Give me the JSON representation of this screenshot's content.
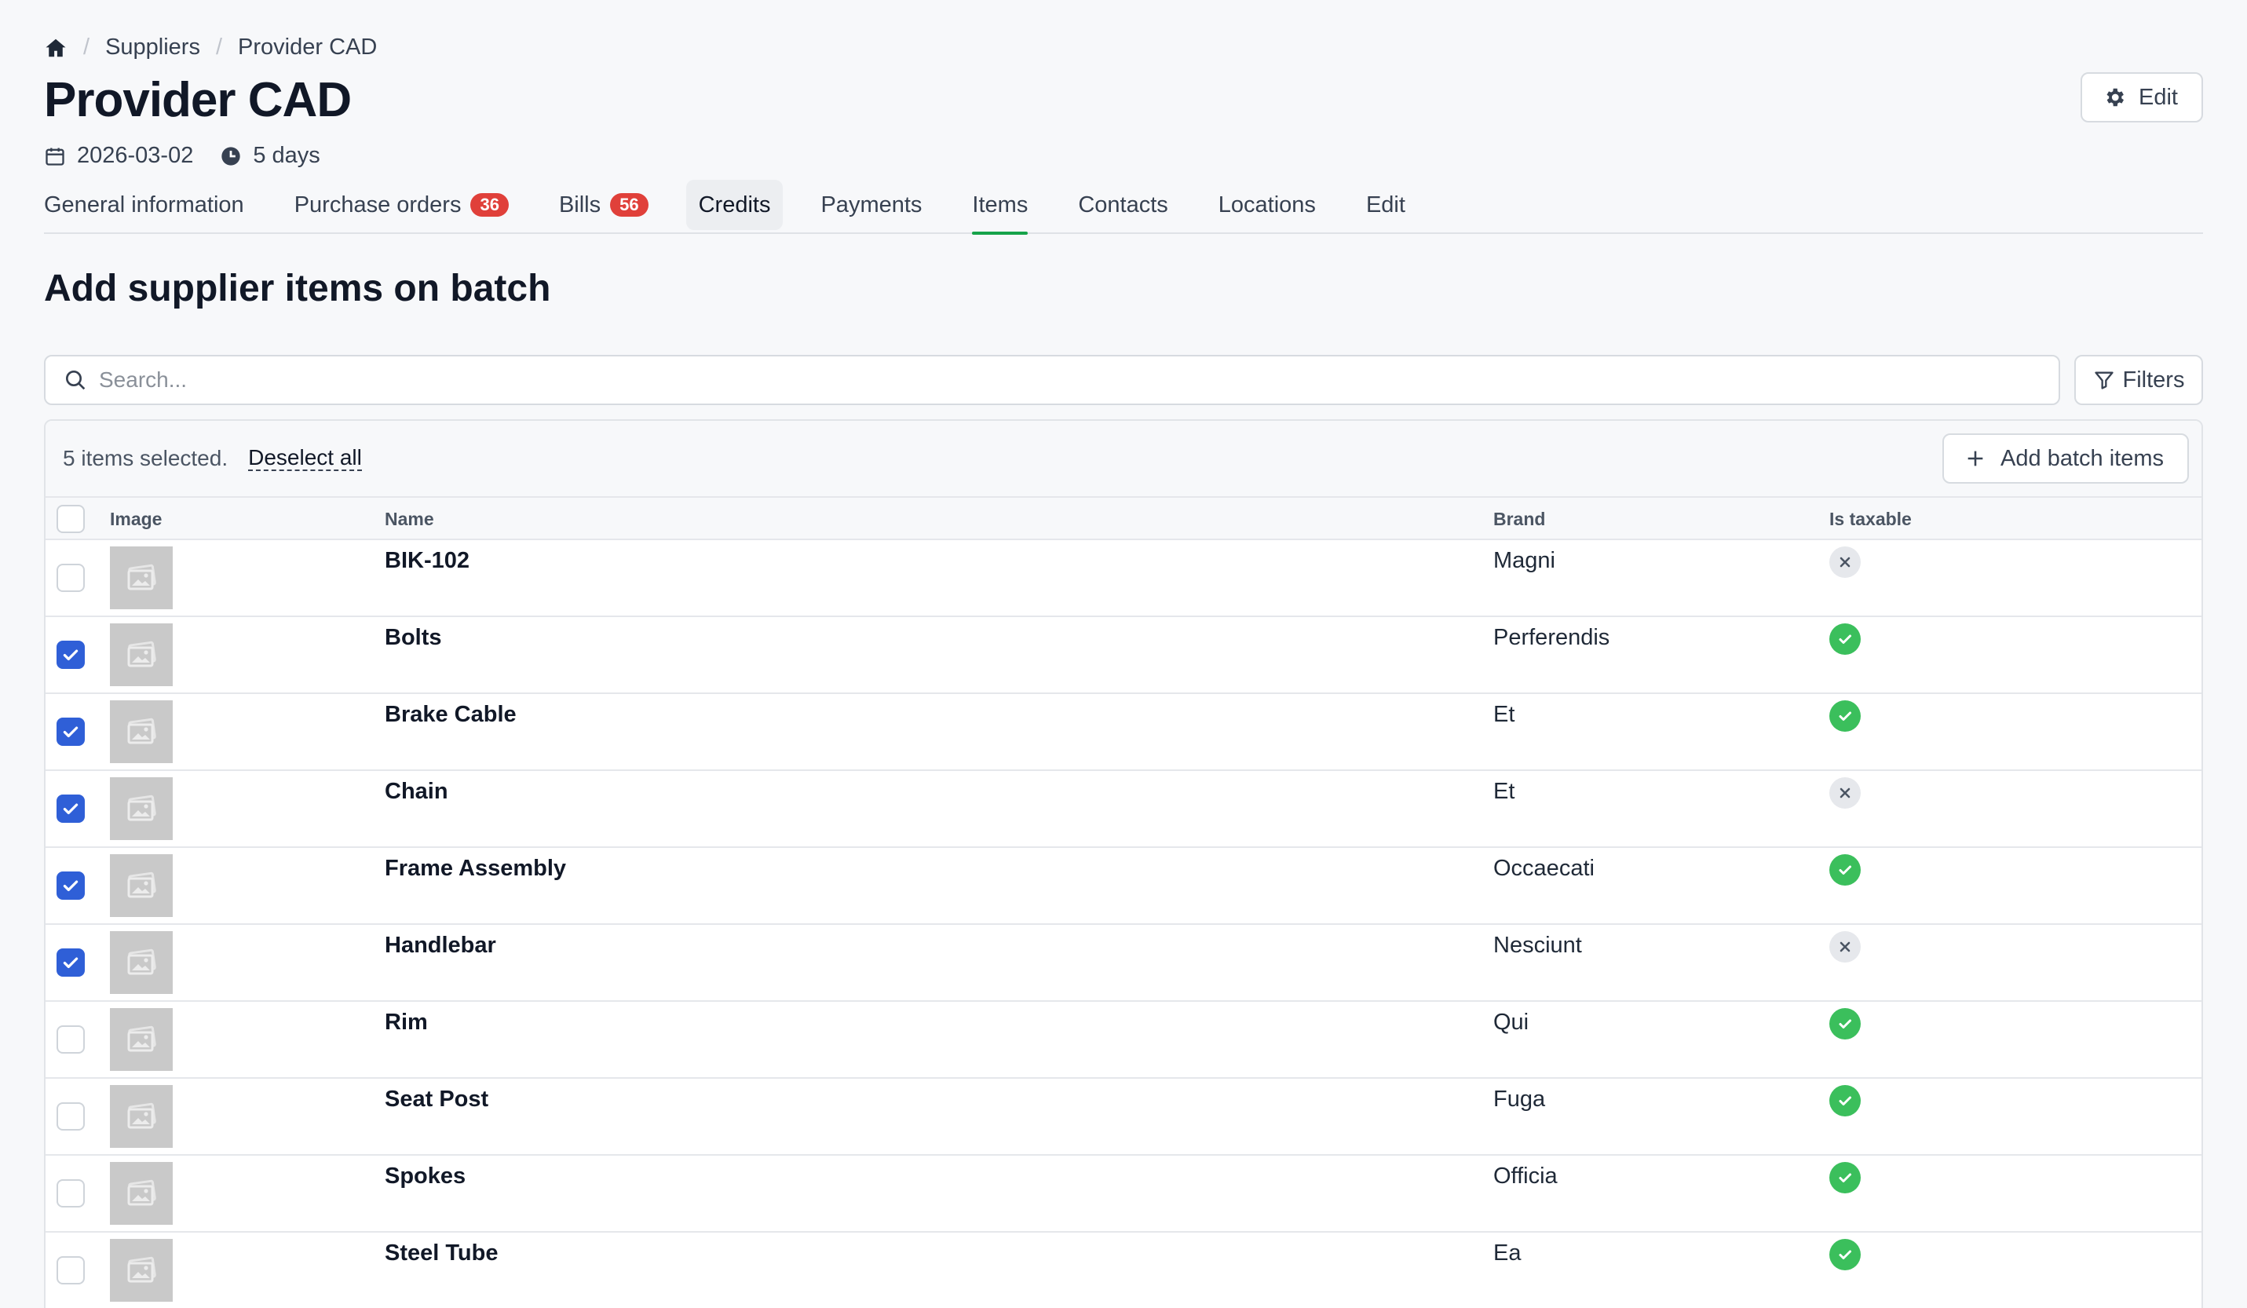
{
  "breadcrumb": {
    "items": [
      "Suppliers",
      "Provider CAD"
    ],
    "separator": "/"
  },
  "header": {
    "title": "Provider CAD",
    "date": "2026-03-02",
    "duration": "5 days",
    "edit_label": "Edit"
  },
  "tabs": [
    {
      "label": "General information"
    },
    {
      "label": "Purchase orders",
      "badge": "36"
    },
    {
      "label": "Bills",
      "badge": "56"
    },
    {
      "label": "Credits"
    },
    {
      "label": "Payments"
    },
    {
      "label": "Items"
    },
    {
      "label": "Contacts"
    },
    {
      "label": "Locations"
    },
    {
      "label": "Edit"
    }
  ],
  "active_tab": "Items",
  "section": {
    "title": "Add supplier items on batch"
  },
  "search": {
    "placeholder": "Search...",
    "value": ""
  },
  "filters_label": "Filters",
  "selection": {
    "text": "5 items selected.",
    "deselect_label": "Deselect all",
    "add_batch_label": "Add batch items"
  },
  "table": {
    "headers": {
      "image": "Image",
      "name": "Name",
      "brand": "Brand",
      "taxable": "Is taxable"
    },
    "rows": [
      {
        "name": "BIK-102",
        "brand": "Magni",
        "taxable": false,
        "selected": false
      },
      {
        "name": "Bolts",
        "brand": "Perferendis",
        "taxable": true,
        "selected": true
      },
      {
        "name": "Brake Cable",
        "brand": "Et",
        "taxable": true,
        "selected": true
      },
      {
        "name": "Chain",
        "brand": "Et",
        "taxable": false,
        "selected": true
      },
      {
        "name": "Frame Assembly",
        "brand": "Occaecati",
        "taxable": true,
        "selected": true
      },
      {
        "name": "Handlebar",
        "brand": "Nesciunt",
        "taxable": false,
        "selected": true
      },
      {
        "name": "Rim",
        "brand": "Qui",
        "taxable": true,
        "selected": false
      },
      {
        "name": "Seat Post",
        "brand": "Fuga",
        "taxable": true,
        "selected": false
      },
      {
        "name": "Spokes",
        "brand": "Officia",
        "taxable": true,
        "selected": false
      },
      {
        "name": "Steel Tube",
        "brand": "Ea",
        "taxable": true,
        "selected": false
      }
    ]
  },
  "colors": {
    "accent": "#2f5fd7",
    "active_tab_underline": "#16a34a",
    "badge": "#e0403a",
    "taxable_yes": "#3bbf5c",
    "taxable_no": "#e6e8ec"
  },
  "icons": {
    "home": "home-icon",
    "calendar": "calendar-icon",
    "clock": "clock-icon",
    "settings": "gear-icon",
    "search": "search-icon",
    "filter": "filter-icon",
    "plus": "plus-icon",
    "image_placeholder": "image-placeholder-icon",
    "check": "check-icon",
    "close": "close-icon"
  }
}
